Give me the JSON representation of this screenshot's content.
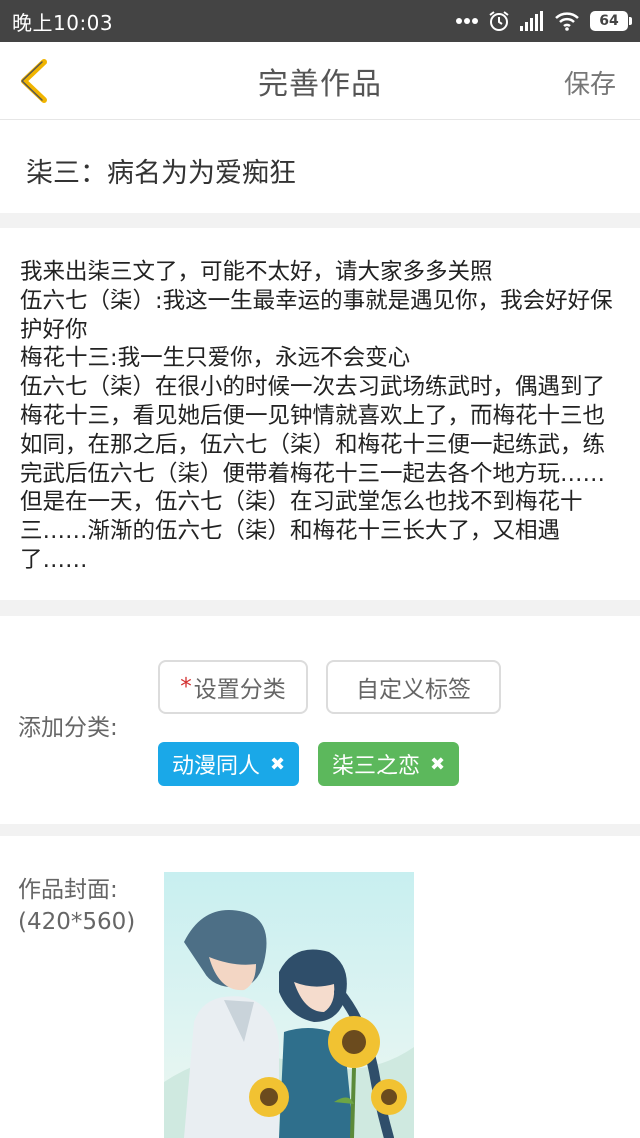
{
  "status_bar": {
    "time": "晚上10:03",
    "battery": "64"
  },
  "nav": {
    "title": "完善作品",
    "save_label": "保存",
    "back_icon": "chevron-left-icon",
    "accent_color": "#f0b400"
  },
  "work": {
    "title": "柒三：病名为为爱痴狂",
    "content": "我来出柒三文了，可能不太好，请大家多多关照\n伍六七（柒）:我这一生最幸运的事就是遇见你，我会好好保护好你\n梅花十三:我一生只爱你，永远不会变心\n伍六七（柒）在很小的时候一次去习武场练武时，偶遇到了梅花十三，看见她后便一见钟情就喜欢上了，而梅花十三也如同，在那之后，伍六七（柒）和梅花十三便一起练武，练完武后伍六七（柒）便带着梅花十三一起去各个地方玩……但是在一天，伍六七（柒）在习武堂怎么也找不到梅花十三……渐渐的伍六七（柒）和梅花十三长大了，又相遇了……"
  },
  "category": {
    "label": "添加分类:",
    "set_category_required": "*",
    "set_category_label": "设置分类",
    "custom_tag_label": "自定义标签",
    "tags": [
      {
        "label": "动漫同人",
        "color": "#1aa8e8",
        "remove_icon": "close-icon"
      },
      {
        "label": "柒三之恋",
        "color": "#5cb85c",
        "remove_icon": "close-icon"
      }
    ]
  },
  "cover": {
    "label_line1": "作品封面:",
    "label_line2": "(420*560)"
  }
}
